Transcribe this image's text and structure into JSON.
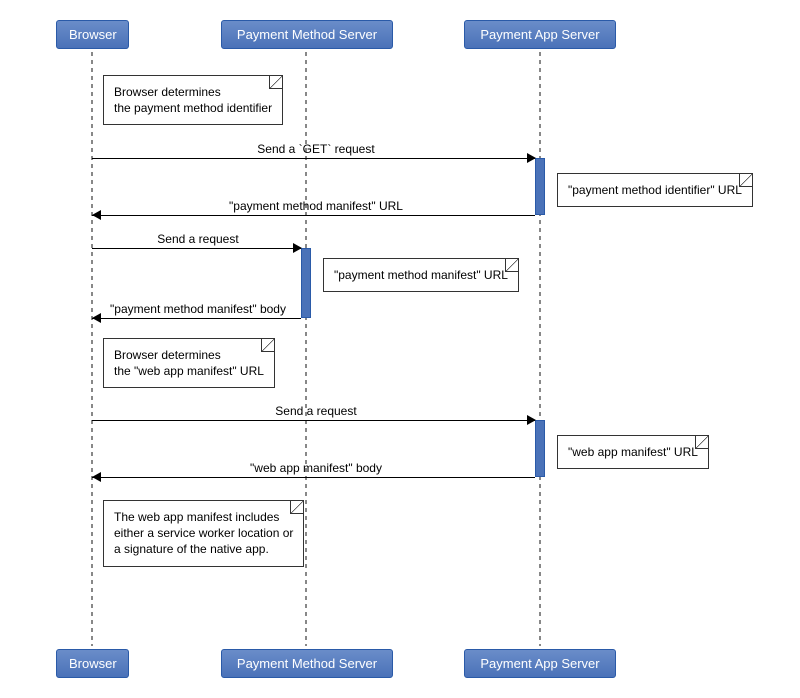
{
  "participants": {
    "browser": "Browser",
    "pms": "Payment Method Server",
    "pas": "Payment App Server"
  },
  "notes": {
    "n1_l1": "Browser determines",
    "n1_l2": "the payment method identifier",
    "n2": "\"payment method identifier\" URL",
    "n3": "\"payment method manifest\" URL",
    "n4_l1": "Browser determines",
    "n4_l2": "the \"web app manifest\" URL",
    "n5": "\"web app manifest\" URL",
    "n6_l1": "The web app manifest includes",
    "n6_l2": "either a service worker location or",
    "n6_l3": "a signature of the native app."
  },
  "messages": {
    "m1": "Send a `GET` request",
    "m2": "\"payment method manifest\" URL",
    "m3": "Send a request",
    "m4": "\"payment method manifest\" body",
    "m5": "Send a request",
    "m6": "\"web app manifest\" body"
  }
}
